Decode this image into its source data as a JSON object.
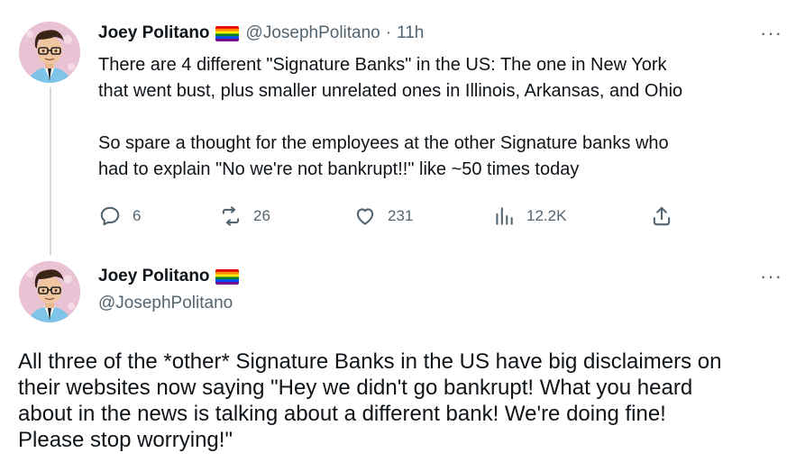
{
  "tweet1": {
    "author_name": "Joey Politano",
    "handle": "@JosephPolitano",
    "separator": "·",
    "time": "11h",
    "more_label": "···",
    "lines": [
      "There are 4 different \"Signature Banks\" in the US: The one in New York",
      "that went bust, plus smaller unrelated ones in Illinois, Arkansas, and Ohio",
      "So spare a thought for the employees at the other Signature banks who",
      "had to explain \"No we're not bankrupt!!\" like ~50 times today"
    ],
    "actions": {
      "replies": "6",
      "retweets": "26",
      "likes": "231",
      "views": "12.2K"
    }
  },
  "tweet2": {
    "author_name": "Joey Politano",
    "handle": "@JosephPolitano",
    "more_label": "···",
    "lines": [
      "All three of the *other* Signature Banks in the US have big disclaimers on",
      "their websites now saying \"Hey we didn't go bankrupt! What you heard",
      "about in the news is talking about a different bank! We're doing fine!",
      "Please stop worrying!\""
    ]
  },
  "icons": {
    "reply": "speech-bubble-icon",
    "retweet": "retweet-icon",
    "like": "heart-icon",
    "views": "bar-chart-icon",
    "share": "share-upload-icon",
    "flag": "rainbow-flag-icon"
  },
  "colors": {
    "text": "#0f1419",
    "muted": "#536471",
    "thread_line": "#cfd9de",
    "avatar_bg": "#e8bfd0"
  }
}
